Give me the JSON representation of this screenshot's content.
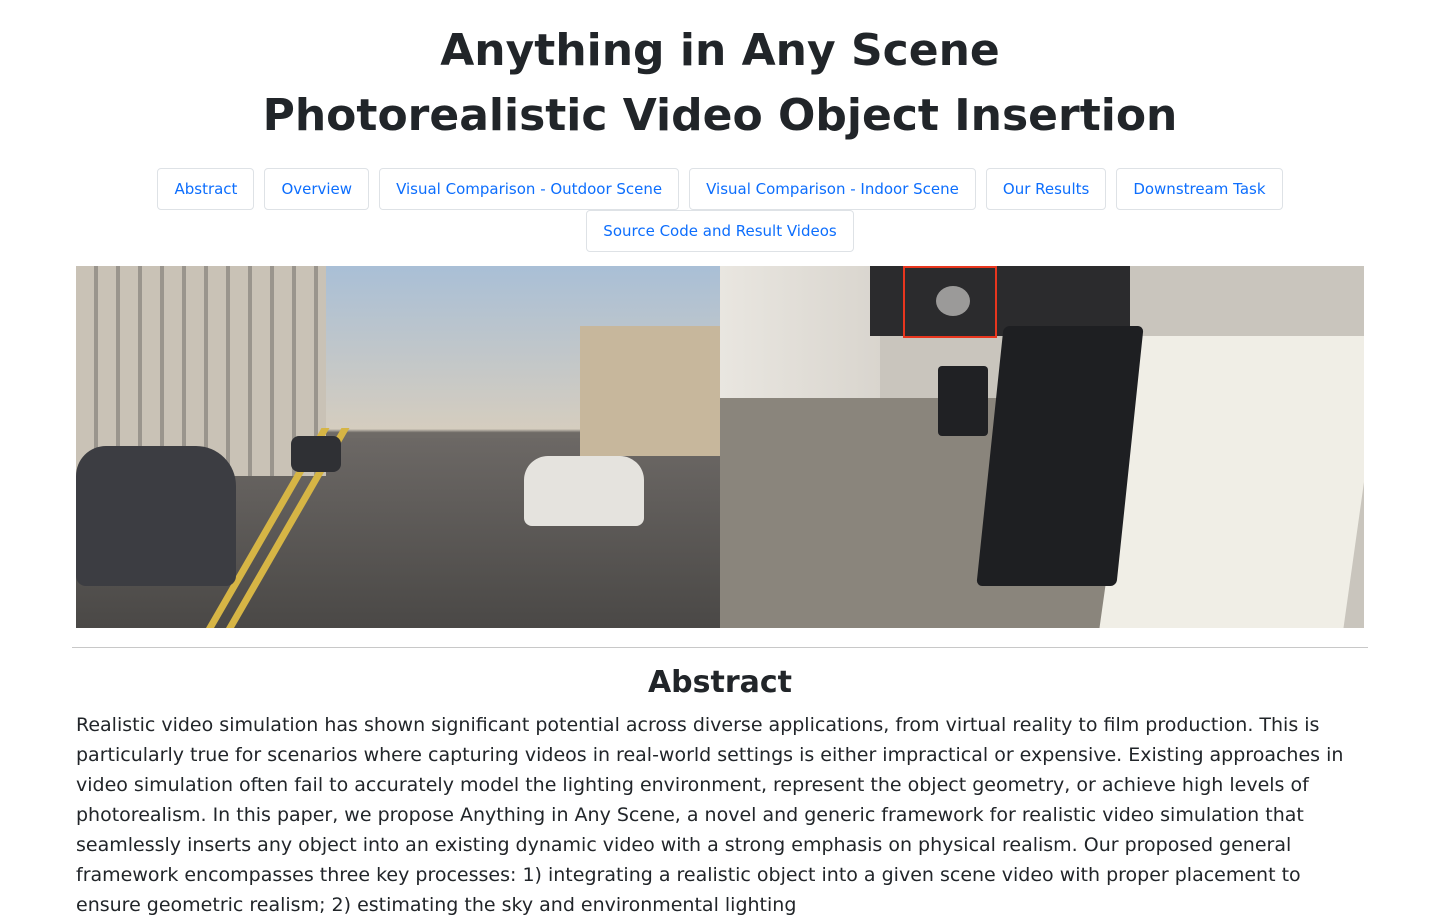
{
  "header": {
    "title_line1": "Anything in Any Scene",
    "title_line2": "Photorealistic Video Object Insertion"
  },
  "nav": {
    "items": [
      {
        "label": "Abstract"
      },
      {
        "label": "Overview"
      },
      {
        "label": "Visual Comparison - Outdoor Scene"
      },
      {
        "label": "Visual Comparison - Indoor Scene"
      },
      {
        "label": "Our Results"
      },
      {
        "label": "Downstream Task"
      },
      {
        "label": "Source Code and Result Videos"
      }
    ]
  },
  "teaser": {
    "left_scene": "outdoor street scene",
    "right_scene": "indoor office scene",
    "highlight_color": "#e8361e"
  },
  "abstract": {
    "heading": "Abstract",
    "text": "Realistic video simulation has shown significant potential across diverse applications, from virtual reality to film production. This is particularly true for scenarios where capturing videos in real-world settings is either impractical or expensive. Existing approaches in video simulation often fail to accurately model the lighting environment, represent the object geometry, or achieve high levels of photorealism. In this paper, we propose Anything in Any Scene, a novel and generic framework for realistic video simulation that seamlessly inserts any object into an existing dynamic video with a strong emphasis on physical realism. Our proposed general framework encompasses three key processes: 1) integrating a realistic object into a given scene video with proper placement to ensure geometric realism; 2) estimating the sky and environmental lighting"
  },
  "colors": {
    "link": "#0d6efd",
    "text": "#212529",
    "border": "#dee2e6"
  }
}
